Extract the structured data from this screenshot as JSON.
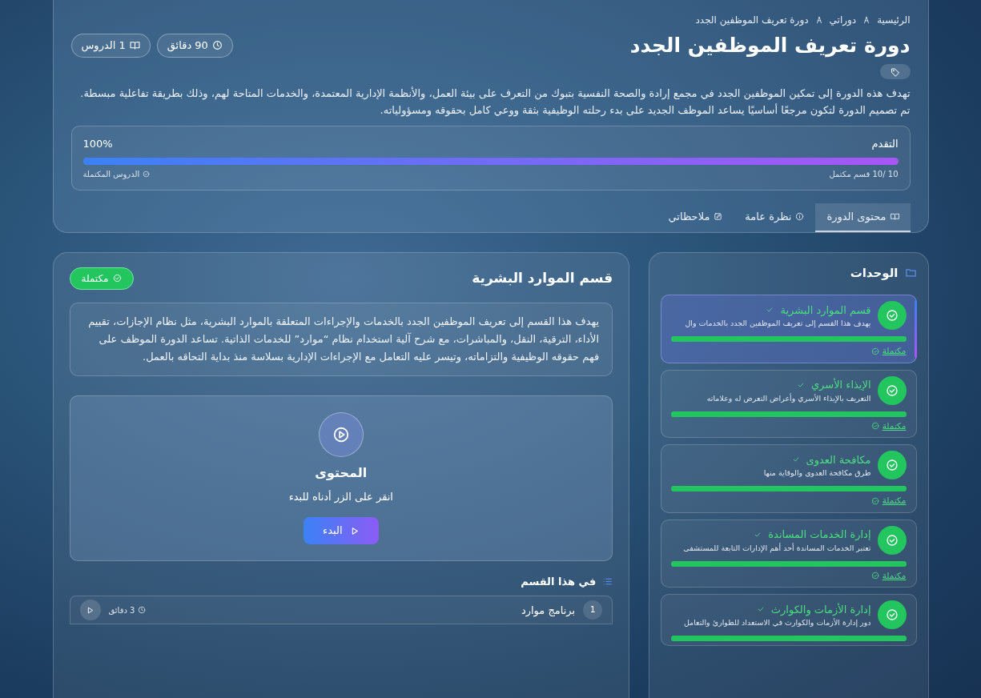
{
  "breadcrumb": [
    {
      "label": "الرئيسية"
    },
    {
      "label": "دوراتي"
    },
    {
      "label": "دورة تعريف الموظفين الجدد"
    }
  ],
  "course": {
    "title": "دورة تعريف الموظفين الجدد",
    "meta": [
      {
        "kind": "duration",
        "text": "90 دقائق"
      },
      {
        "kind": "lessons",
        "text": "1 الدروس"
      }
    ],
    "description": "تهدف هذه الدورة إلى تمكين الموظفين الجدد في مجمع إرادة والصحة النفسية بتبوك من التعرف على بيئة العمل، والأنظمة الإدارية المعتمدة، والخدمات المتاحة لهم، وذلك بطريقة تفاعلية مبسطة. تم تصميم الدورة لتكون مرجعًا أساسيًا يساعد الموظف الجديد على بدء رحلته الوظيفية بثقة ووعي كامل بحقوقه ومسؤولياته."
  },
  "progress": {
    "label": "التقدم",
    "percent": "100%",
    "level": 1,
    "sections_text": "10 /10 قسم مكتمل",
    "completed_text": "الدروس المكتملة"
  },
  "tabs": [
    {
      "label": "محتوى الدورة",
      "selected": true
    },
    {
      "label": "نظرة عامة",
      "selected": false
    },
    {
      "label": "ملاحظاتي",
      "selected": false
    }
  ],
  "modules": {
    "title": "الوحدات",
    "items": [
      {
        "title": "قسم الموارد البشرية",
        "description": "يهدف هذا القسم إلى تعريف الموظفين الجدد بالخدمات وال",
        "level": 1,
        "status": "مكتملة",
        "selected": true
      },
      {
        "title": "الإيذاء الأسري",
        "description": "التعريف بالإيذاء الأسري وأعراض التعرض له وعلاماته",
        "level": 1,
        "status": "مكتملة",
        "selected": false
      },
      {
        "title": "مكافحة العدوى",
        "description": "طرق مكافحة العدوى والوقاية منها",
        "level": 1,
        "status": "مكتملة",
        "selected": false
      },
      {
        "title": "إدارة الخدمات المساندة",
        "description": "تعتبر الخدمات المساندة أحد أهم الإدارات التابعة للمستشفى",
        "level": 1,
        "status": "مكتملة",
        "selected": false
      },
      {
        "title": "إدارة الأزمات والكوارث",
        "description": "دور إدارة الأزمات والكوارث في الاستعداد للطوارئ والتعامل",
        "level": 1,
        "selected": false
      }
    ]
  },
  "section": {
    "title": "قسم الموارد البشرية",
    "status": "مكتملة",
    "description": "يهدف هذا القسم إلى تعريف الموظفين الجدد بالخدمات والإجراءات المتعلقة بالموارد البشرية، مثل نظام الإجازات، تقييم الأداء، الترقية، النقل، والمباشرات، مع شرح آلية استخدام نظام “موارد” للخدمات الذاتية. تساعد الدورة الموظف على فهم حقوقه الوظيفية والتزاماته، وتيسر عليه التعامل مع الإجراءات الإدارية بسلاسة منذ بداية التحاقه بالعمل.",
    "content": {
      "title": "المحتوى",
      "hint": "انقر على الزر أدناه للبدء",
      "button": "البدء"
    },
    "list_title": "في هذا القسم",
    "lessons": [
      {
        "number": "1",
        "title": "برنامج موارد",
        "duration": "3 دقائق"
      }
    ]
  }
}
